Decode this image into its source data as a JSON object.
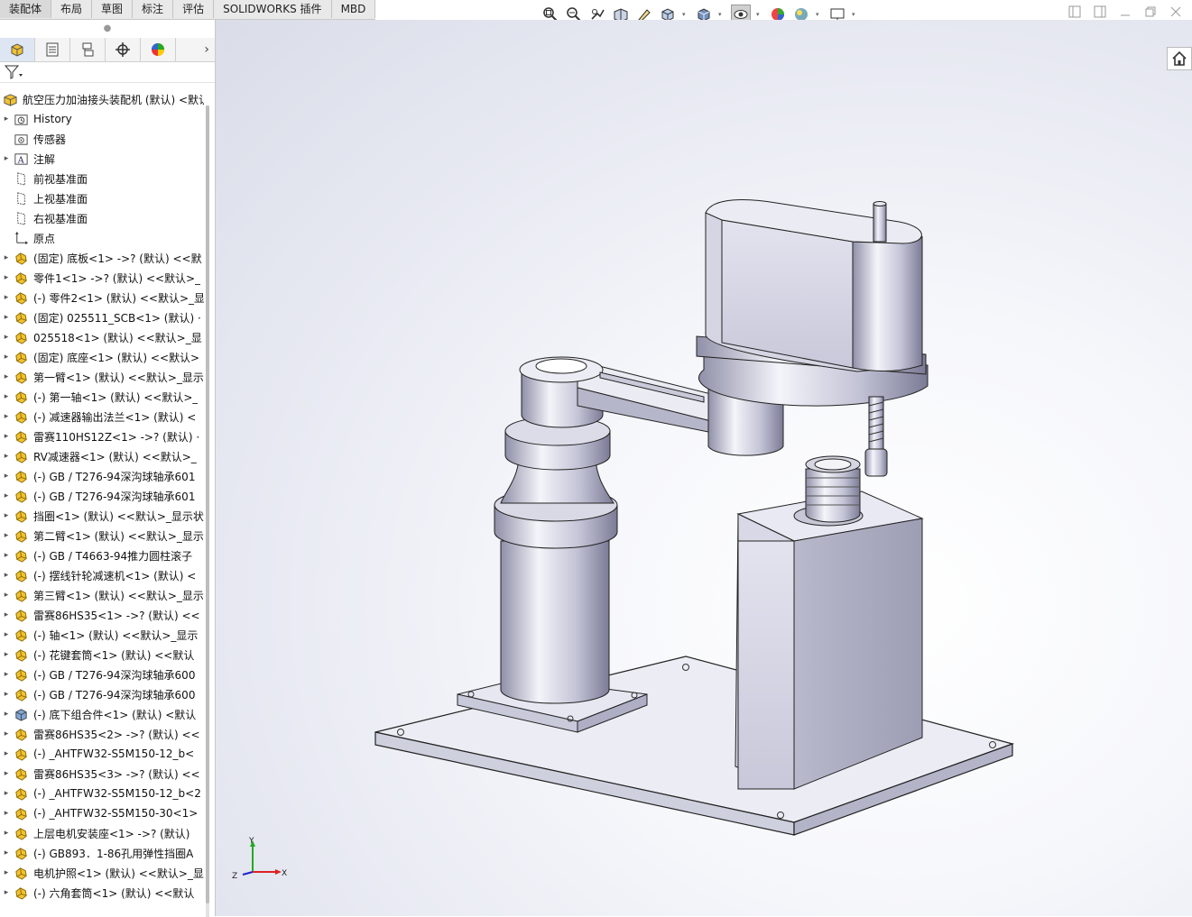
{
  "tabs": [
    "装配体",
    "布局",
    "草图",
    "标注",
    "评估",
    "SOLIDWORKS 插件",
    "MBD"
  ],
  "toolbar_icons": [
    "zoom-to-fit-icon",
    "zoom-area-icon",
    "previous-view-icon",
    "section-view-icon",
    "dynamic-annotation-icon",
    "view-orientation-icon",
    "display-style-icon",
    "hide-show-items-icon",
    "edit-appearance-icon",
    "apply-scene-icon",
    "view-settings-icon"
  ],
  "window_controls": [
    "tile-left-icon",
    "tile-right-icon",
    "minimize-icon",
    "restore-icon",
    "close-icon"
  ],
  "panel_tabs": [
    "feature-manager-icon",
    "property-manager-icon",
    "configuration-manager-icon",
    "dimxpert-icon",
    "display-manager-icon"
  ],
  "tree": {
    "root": "航空压力加油接头装配机 (默认) <默认",
    "items": [
      {
        "label": "History",
        "icon": "history-folder-icon",
        "expand": true
      },
      {
        "label": "传感器",
        "icon": "sensor-icon",
        "expand": false
      },
      {
        "label": "注解",
        "icon": "annotation-icon",
        "expand": true
      },
      {
        "label": "前视基准面",
        "icon": "plane-icon",
        "expand": false
      },
      {
        "label": "上视基准面",
        "icon": "plane-icon",
        "expand": false
      },
      {
        "label": "右视基准面",
        "icon": "plane-icon",
        "expand": false
      },
      {
        "label": "原点",
        "icon": "origin-icon",
        "expand": false
      },
      {
        "label": "(固定) 底板<1> ->? (默认) <<默",
        "icon": "part-icon",
        "expand": true
      },
      {
        "label": "零件1<1> ->? (默认) <<默认>_",
        "icon": "part-icon",
        "expand": true
      },
      {
        "label": "(-) 零件2<1> (默认) <<默认>_显",
        "icon": "part-icon",
        "expand": true
      },
      {
        "label": "(固定) 025511_SCB<1> (默认) ·",
        "icon": "part-icon",
        "expand": true
      },
      {
        "label": "025518<1> (默认) <<默认>_显",
        "icon": "part-icon",
        "expand": true
      },
      {
        "label": "(固定) 底座<1> (默认) <<默认>",
        "icon": "part-icon",
        "expand": true
      },
      {
        "label": "第一臂<1> (默认) <<默认>_显示",
        "icon": "part-icon",
        "expand": true
      },
      {
        "label": "(-) 第一轴<1> (默认) <<默认>_",
        "icon": "part-icon",
        "expand": true
      },
      {
        "label": "(-) 减速器输出法兰<1> (默认) <",
        "icon": "part-icon",
        "expand": true
      },
      {
        "label": "雷赛110HS12Z<1> ->? (默认) ·",
        "icon": "part-icon",
        "expand": true
      },
      {
        "label": "RV减速器<1> (默认) <<默认>_",
        "icon": "part-icon",
        "expand": true
      },
      {
        "label": "(-) GB / T276-94深沟球轴承601",
        "icon": "part-icon",
        "expand": true
      },
      {
        "label": "(-) GB / T276-94深沟球轴承601",
        "icon": "part-icon",
        "expand": true
      },
      {
        "label": "挡圈<1> (默认) <<默认>_显示状",
        "icon": "part-icon",
        "expand": true
      },
      {
        "label": "第二臂<1> (默认) <<默认>_显示",
        "icon": "part-icon",
        "expand": true
      },
      {
        "label": "(-) GB / T4663-94推力圆柱滚子",
        "icon": "part-icon",
        "expand": true
      },
      {
        "label": "(-) 摆线针轮减速机<1> (默认) <",
        "icon": "part-icon",
        "expand": true
      },
      {
        "label": "第三臂<1> (默认) <<默认>_显示",
        "icon": "part-icon",
        "expand": true
      },
      {
        "label": "雷赛86HS35<1> ->? (默认) <<",
        "icon": "part-icon",
        "expand": true
      },
      {
        "label": "(-) 轴<1> (默认) <<默认>_显示",
        "icon": "part-icon",
        "expand": true
      },
      {
        "label": "(-) 花键套筒<1> (默认) <<默认",
        "icon": "part-icon",
        "expand": true
      },
      {
        "label": "(-) GB / T276-94深沟球轴承600",
        "icon": "part-icon",
        "expand": true
      },
      {
        "label": "(-) GB / T276-94深沟球轴承600",
        "icon": "part-icon",
        "expand": true
      },
      {
        "label": "(-) 底下组合件<1> (默认) <默认",
        "icon": "subassembly-icon",
        "expand": true
      },
      {
        "label": "雷赛86HS35<2> ->? (默认) <<",
        "icon": "part-icon",
        "expand": true
      },
      {
        "label": "(-) _AHTFW32-S5M150-12_b<",
        "icon": "part-icon",
        "expand": true
      },
      {
        "label": "雷赛86HS35<3> ->? (默认) <<",
        "icon": "part-icon",
        "expand": true
      },
      {
        "label": "(-) _AHTFW32-S5M150-12_b<2",
        "icon": "part-icon",
        "expand": true
      },
      {
        "label": "(-) _AHTFW32-S5M150-30<1>",
        "icon": "part-icon",
        "expand": true
      },
      {
        "label": "上层电机安装座<1> ->? (默认)",
        "icon": "part-icon",
        "expand": true
      },
      {
        "label": "(-) GB893．1-86孔用弹性挡圈A",
        "icon": "part-icon",
        "expand": true
      },
      {
        "label": "电机护照<1> (默认) <<默认>_显",
        "icon": "part-icon",
        "expand": true
      },
      {
        "label": "(-) 六角套筒<1> (默认) <<默认",
        "icon": "part-icon",
        "expand": true
      }
    ]
  },
  "triad": {
    "x": "X",
    "y": "Y",
    "z": "Z"
  },
  "colors": {
    "accent": "#0078d7",
    "part_yellow": "#f1c232",
    "model_face": "#d6d6e6",
    "model_shade": "#a9a9c2"
  }
}
